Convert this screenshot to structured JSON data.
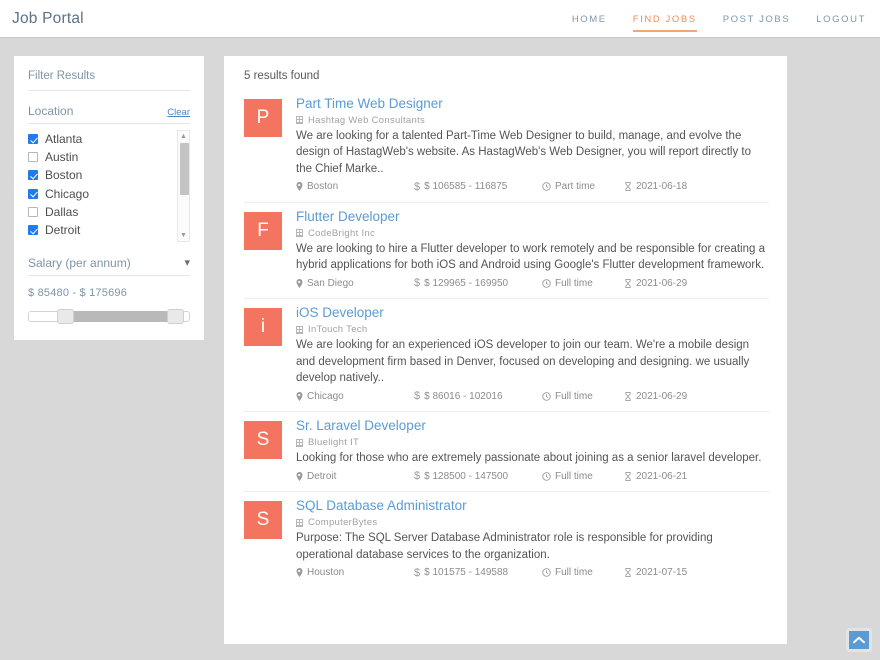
{
  "header": {
    "brand": "Job Portal",
    "nav": [
      {
        "label": "HOME",
        "active": false
      },
      {
        "label": "FIND JOBS",
        "active": true
      },
      {
        "label": "POST JOBS",
        "active": false
      },
      {
        "label": "LOGOUT",
        "active": false
      }
    ],
    "accent_color": "#f08b5a",
    "link_color": "#7d97ad"
  },
  "sidebar": {
    "title": "Filter Results",
    "location": {
      "label": "Location",
      "clear_label": "Clear",
      "items": [
        {
          "label": "Atlanta",
          "checked": true
        },
        {
          "label": "Austin",
          "checked": false
        },
        {
          "label": "Boston",
          "checked": true
        },
        {
          "label": "Chicago",
          "checked": true
        },
        {
          "label": "Dallas",
          "checked": false
        },
        {
          "label": "Detroit",
          "checked": true
        }
      ]
    },
    "salary": {
      "label": "Salary (per annum)",
      "range_text": "$ 85480 - $ 175696",
      "min": 85480,
      "max": 175696
    }
  },
  "results": {
    "count_text": "5 results found",
    "jobs": [
      {
        "initial": "P",
        "title": "Part Time Web Designer",
        "company": "Hashtag Web Consultants",
        "description": "We are looking for a talented Part-Time Web Designer to build, manage, and evolve the design of HastagWeb's website. As HastagWeb's Web Designer, you will report directly to the Chief Marke..",
        "location": "Boston",
        "salary": "$ 106585 - 116875",
        "type": "Part time",
        "date": "2021-06-18"
      },
      {
        "initial": "F",
        "title": "Flutter Developer",
        "company": "CodeBright Inc",
        "description": "We are looking to hire a Flutter developer to work remotely and be responsible for creating a hybrid applications for both iOS and Android using Google's Flutter development framework.",
        "location": "San Diego",
        "salary": "$ 129965 - 169950",
        "type": "Full time",
        "date": "2021-06-29"
      },
      {
        "initial": "i",
        "title": "iOS Developer",
        "company": "InTouch Tech",
        "description": "We are looking for an experienced iOS developer to join our team. We're a mobile design and development firm based in Denver, focused on developing and designing. we usually develop natively..",
        "location": "Chicago",
        "salary": "$ 86016 - 102016",
        "type": "Full time",
        "date": "2021-06-29"
      },
      {
        "initial": "S",
        "title": "Sr. Laravel Developer",
        "company": "Bluelight IT",
        "description": "Looking for those who are extremely passionate about joining as a senior laravel developer.",
        "location": "Detroit",
        "salary": "$ 128500 - 147500",
        "type": "Full time",
        "date": "2021-06-21"
      },
      {
        "initial": "S",
        "title": "SQL Database Administrator",
        "company": "ComputerBytes",
        "description": "Purpose: The SQL Server Database Administrator role is responsible for providing operational database services to the organization.",
        "location": "Houston",
        "salary": "$ 101575 - 149588",
        "type": "Full time",
        "date": "2021-07-15"
      }
    ],
    "avatar_color": "#f4755f",
    "title_color": "#5b9bd5"
  },
  "scroll_top": {
    "icon": "chevron-up-icon",
    "color": "#5b9bd5"
  }
}
